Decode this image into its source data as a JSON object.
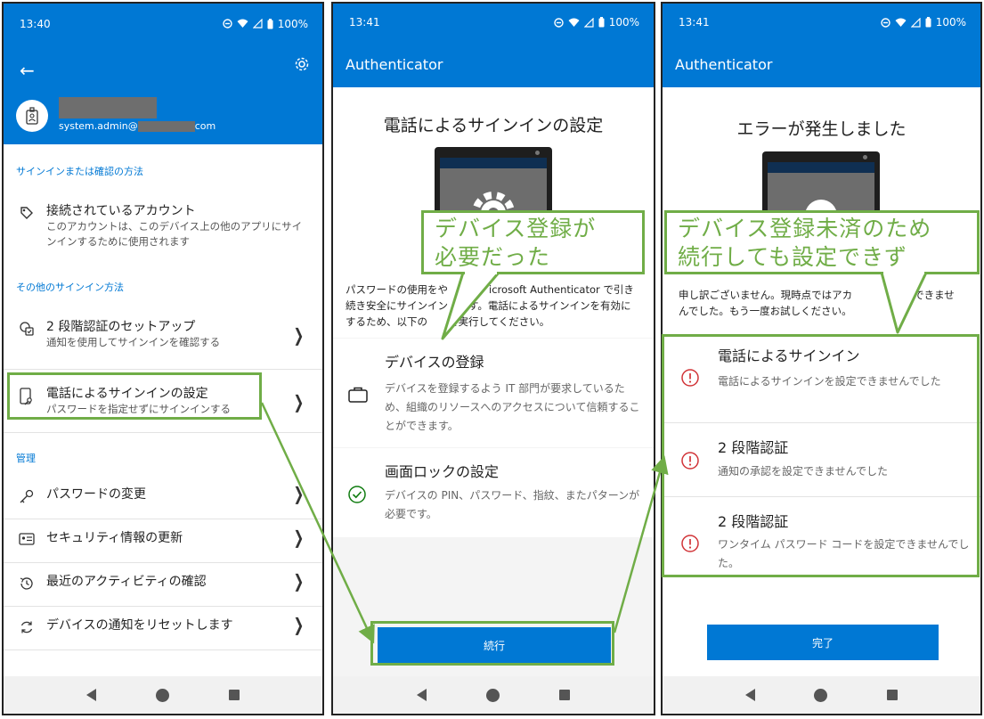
{
  "screens": [
    {
      "status": {
        "time": "13:40",
        "battery": "100%"
      },
      "account": {
        "email": "system.admin@",
        "email_suffix": "com"
      },
      "section1": {
        "label": "サインインまたは確認の方法",
        "items": [
          {
            "title": "接続されているアカウント",
            "subtitle": "このアカウントは、このデバイス上の他のアプリにサインインするために使用されます"
          }
        ]
      },
      "section2": {
        "label": "その他のサインイン方法",
        "items": [
          {
            "title": "2 段階認証のセットアップ",
            "subtitle": "通知を使用してサインインを確認する"
          },
          {
            "title": "電話によるサインインの設定",
            "subtitle": "パスワードを指定せずにサインインする"
          }
        ]
      },
      "section3": {
        "label": "管理",
        "items": [
          {
            "title": "パスワードの変更"
          },
          {
            "title": "セキュリティ情報の更新"
          },
          {
            "title": "最近のアクティビティの確認"
          },
          {
            "title": "デバイスの通知をリセットします"
          }
        ]
      }
    },
    {
      "status": {
        "time": "13:41",
        "battery": "100%"
      },
      "appbar_title": "Authenticator",
      "title": "電話によるサインインの設定",
      "description": "パスワードの使用をや　　　　icrosoft Authenticator で引き続き安全にサインイン　　す。電話によるサインインを有効にするため、以下の　　を実行してください。",
      "items": [
        {
          "title": "デバイスの登録",
          "subtitle": "デバイスを登録するよう IT 部門が要求しているため、組織のリソースへのアクセスについて信頼することができます。"
        },
        {
          "title": "画面ロックの設定",
          "subtitle": "デバイスの PIN、パスワード、指紋、またパターンが必要です。"
        }
      ],
      "button": "続行"
    },
    {
      "status": {
        "time": "13:41",
        "battery": "100%"
      },
      "appbar_title": "Authenticator",
      "title": "エラーが発生しました",
      "description": "申し訳ございません。現時点ではアカ　　　　　加できませんでした。もう一度お試しください。",
      "errors": [
        {
          "title": "電話によるサインイン",
          "subtitle": "電話によるサインインを設定できませんでした"
        },
        {
          "title": "2 段階認証",
          "subtitle": "通知の承認を設定できませんでした"
        },
        {
          "title": "2 段階認証",
          "subtitle": "ワンタイム パスワード コードを設定できませんでした。"
        }
      ],
      "button": "完了"
    }
  ],
  "annotations": {
    "callout1": [
      "デバイス登録が",
      "必要だった"
    ],
    "callout2": [
      "デバイス登録未済のため",
      "続行しても設定できず"
    ],
    "color": "#70ad47"
  },
  "colors": {
    "brand": "#0078d4",
    "error": "#d13438",
    "success": "#107c10"
  }
}
